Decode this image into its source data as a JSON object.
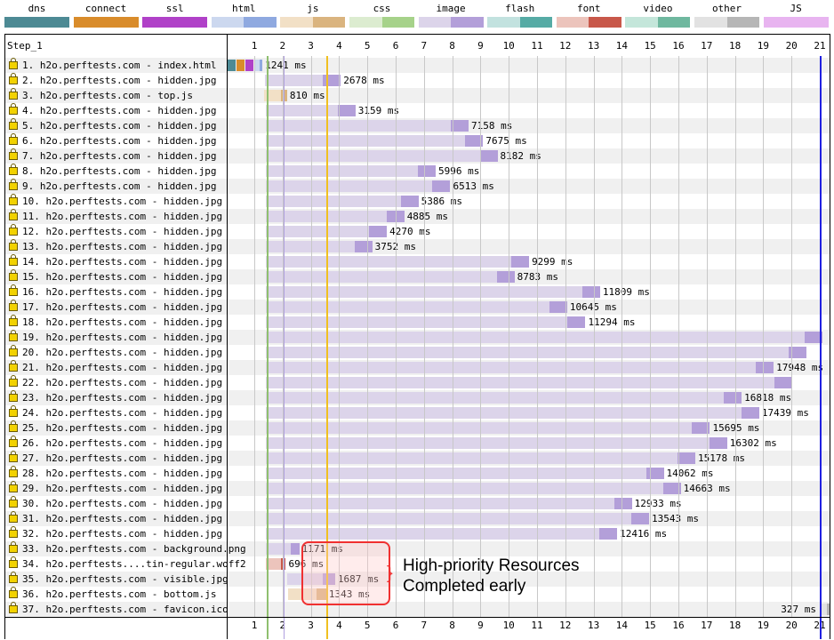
{
  "legend": [
    {
      "label": "dns",
      "light": "#4d8a94",
      "dark": "#4d8a94"
    },
    {
      "label": "connect",
      "light": "#d98c2b",
      "dark": "#d98c2b"
    },
    {
      "label": "ssl",
      "light": "#b041c8",
      "dark": "#b041c8"
    },
    {
      "label": "html",
      "light": "#ccd8ef",
      "dark": "#8fa9e0"
    },
    {
      "label": "js",
      "light": "#f2e0c6",
      "dark": "#dab47f"
    },
    {
      "label": "css",
      "light": "#dcecd0",
      "dark": "#a6d28a"
    },
    {
      "label": "image",
      "light": "#dcd4ea",
      "dark": "#b39fd9"
    },
    {
      "label": "flash",
      "light": "#c2e2df",
      "dark": "#56aba5"
    },
    {
      "label": "font",
      "light": "#ecc4bc",
      "dark": "#c8584a"
    },
    {
      "label": "video",
      "light": "#c4e6da",
      "dark": "#6fb89f"
    },
    {
      "label": "other",
      "light": "#e2e2e2",
      "dark": "#b6b6b6"
    },
    {
      "label": "JS Execution",
      "light": "#e8b4f0",
      "dark": "#e8b4f0"
    }
  ],
  "step_label": "Step_1",
  "ticks": [
    "1",
    "2",
    "3",
    "4",
    "5",
    "6",
    "7",
    "8",
    "9",
    "10",
    "11",
    "12",
    "13",
    "14",
    "15",
    "16",
    "17",
    "18",
    "19",
    "20",
    "21"
  ],
  "markers": [
    {
      "name": "start-render",
      "time": 1.45,
      "color": "#8fbf6f"
    },
    {
      "name": "dom-content-loaded",
      "time": 2.05,
      "color": "#b0a0e0"
    },
    {
      "name": "dom-interactive",
      "time": 3.55,
      "color": "#f0c020"
    },
    {
      "name": "onload",
      "time": 21.0,
      "color": "#2020e0"
    }
  ],
  "requests": [
    {
      "label": "1. h2o.perftests.com - index.html",
      "type": "html",
      "start": 0.05,
      "ms": 1241,
      "text": "1241 ms",
      "conn": true
    },
    {
      "label": "2. h2o.perftests.com - hidden.jpg",
      "type": "image",
      "start": 1.38,
      "ms": 2678,
      "text": "2678 ms"
    },
    {
      "label": "3. h2o.perftests.com - top.js",
      "type": "js",
      "start": 1.35,
      "ms": 810,
      "text": "810 ms"
    },
    {
      "label": "4. h2o.perftests.com - hidden.jpg",
      "type": "image",
      "start": 1.42,
      "ms": 3159,
      "text": "3159 ms"
    },
    {
      "label": "5. h2o.perftests.com - hidden.jpg",
      "type": "image",
      "start": 1.42,
      "ms": 7158,
      "text": "7158 ms"
    },
    {
      "label": "6. h2o.perftests.com - hidden.jpg",
      "type": "image",
      "start": 1.42,
      "ms": 7675,
      "text": "7675 ms"
    },
    {
      "label": "7. h2o.perftests.com - hidden.jpg",
      "type": "image",
      "start": 1.42,
      "ms": 8182,
      "text": "8182 ms"
    },
    {
      "label": "8. h2o.perftests.com - hidden.jpg",
      "type": "image",
      "start": 1.42,
      "ms": 5996,
      "text": "5996 ms"
    },
    {
      "label": "9. h2o.perftests.com - hidden.jpg",
      "type": "image",
      "start": 1.42,
      "ms": 6513,
      "text": "6513 ms"
    },
    {
      "label": "10. h2o.perftests.com - hidden.jpg",
      "type": "image",
      "start": 1.42,
      "ms": 5386,
      "text": "5386 ms"
    },
    {
      "label": "11. h2o.perftests.com - hidden.jpg",
      "type": "image",
      "start": 1.42,
      "ms": 4885,
      "text": "4885 ms"
    },
    {
      "label": "12. h2o.perftests.com - hidden.jpg",
      "type": "image",
      "start": 1.42,
      "ms": 4270,
      "text": "4270 ms"
    },
    {
      "label": "13. h2o.perftests.com - hidden.jpg",
      "type": "image",
      "start": 1.42,
      "ms": 3752,
      "text": "3752 ms"
    },
    {
      "label": "14. h2o.perftests.com - hidden.jpg",
      "type": "image",
      "start": 1.42,
      "ms": 9299,
      "text": "9299 ms"
    },
    {
      "label": "15. h2o.perftests.com - hidden.jpg",
      "type": "image",
      "start": 1.42,
      "ms": 8783,
      "text": "8783 ms"
    },
    {
      "label": "16. h2o.perftests.com - hidden.jpg",
      "type": "image",
      "start": 1.42,
      "ms": 11809,
      "text": "11809 ms"
    },
    {
      "label": "17. h2o.perftests.com - hidden.jpg",
      "type": "image",
      "start": 1.42,
      "ms": 10645,
      "text": "10645 ms"
    },
    {
      "label": "18. h2o.perftests.com - hidden.jpg",
      "type": "image",
      "start": 1.42,
      "ms": 11294,
      "text": "11294 ms"
    },
    {
      "label": "19. h2o.perftests.com - hidden.jpg",
      "type": "image",
      "start": 1.42,
      "ms": 19660,
      "text": ""
    },
    {
      "label": "20. h2o.perftests.com - hidden.jpg",
      "type": "image",
      "start": 1.42,
      "ms": 19100,
      "text": ""
    },
    {
      "label": "21. h2o.perftests.com - hidden.jpg",
      "type": "image",
      "start": 1.42,
      "ms": 17948,
      "text": "17948 ms"
    },
    {
      "label": "22. h2o.perftests.com - hidden.jpg",
      "type": "image",
      "start": 1.42,
      "ms": 18600,
      "text": ""
    },
    {
      "label": "23. h2o.perftests.com - hidden.jpg",
      "type": "image",
      "start": 1.42,
      "ms": 16818,
      "text": "16818 ms"
    },
    {
      "label": "24. h2o.perftests.com - hidden.jpg",
      "type": "image",
      "start": 1.42,
      "ms": 17439,
      "text": "17439 ms"
    },
    {
      "label": "25. h2o.perftests.com - hidden.jpg",
      "type": "image",
      "start": 1.42,
      "ms": 15695,
      "text": "15695 ms"
    },
    {
      "label": "26. h2o.perftests.com - hidden.jpg",
      "type": "image",
      "start": 1.42,
      "ms": 16302,
      "text": "16302 ms"
    },
    {
      "label": "27. h2o.perftests.com - hidden.jpg",
      "type": "image",
      "start": 1.42,
      "ms": 15178,
      "text": "15178 ms"
    },
    {
      "label": "28. h2o.perftests.com - hidden.jpg",
      "type": "image",
      "start": 1.42,
      "ms": 14062,
      "text": "14062 ms"
    },
    {
      "label": "29. h2o.perftests.com - hidden.jpg",
      "type": "image",
      "start": 1.42,
      "ms": 14663,
      "text": "14663 ms"
    },
    {
      "label": "30. h2o.perftests.com - hidden.jpg",
      "type": "image",
      "start": 1.42,
      "ms": 12933,
      "text": "12933 ms"
    },
    {
      "label": "31. h2o.perftests.com - hidden.jpg",
      "type": "image",
      "start": 1.42,
      "ms": 13543,
      "text": "13543 ms"
    },
    {
      "label": "32. h2o.perftests.com - hidden.jpg",
      "type": "image",
      "start": 1.42,
      "ms": 12416,
      "text": "12416 ms"
    },
    {
      "label": "33. h2o.perftests.com - background.png",
      "type": "image",
      "start": 1.42,
      "ms": 1171,
      "text": "1171 ms"
    },
    {
      "label": "34. h2o.perftests....tin-regular.woff2",
      "type": "font",
      "start": 1.42,
      "ms": 696,
      "text": "696 ms"
    },
    {
      "label": "35. h2o.perftests.com - visible.jpg",
      "type": "image",
      "start": 2.17,
      "ms": 1687,
      "text": "1687 ms"
    },
    {
      "label": "36. h2o.perftests.com - bottom.js",
      "type": "js",
      "start": 2.2,
      "ms": 1343,
      "text": "1343 ms"
    },
    {
      "label": "37. h2o.perftests.com - favicon.ico",
      "type": "other",
      "start": 21.03,
      "ms": 327,
      "text": "327 ms",
      "label_left": true
    }
  ],
  "annotation": {
    "line1": "High-priority Resources",
    "line2": "Completed early"
  }
}
